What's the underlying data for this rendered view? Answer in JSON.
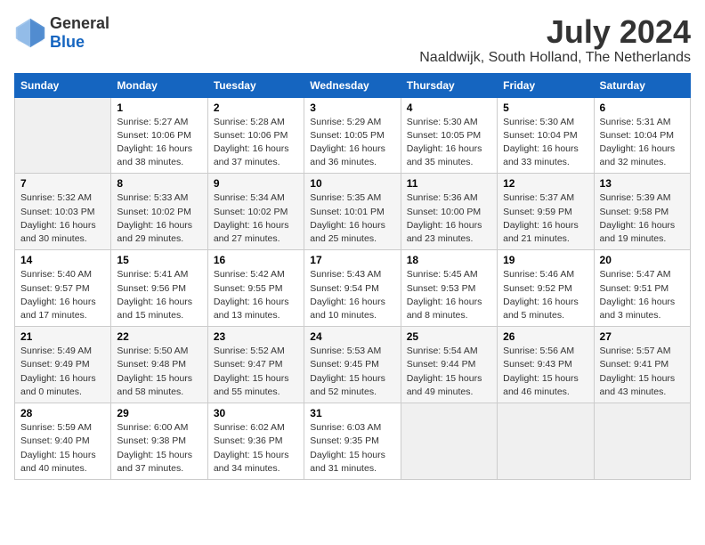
{
  "header": {
    "logo_general": "General",
    "logo_blue": "Blue",
    "month": "July 2024",
    "location": "Naaldwijk, South Holland, The Netherlands"
  },
  "days_of_week": [
    "Sunday",
    "Monday",
    "Tuesday",
    "Wednesday",
    "Thursday",
    "Friday",
    "Saturday"
  ],
  "weeks": [
    [
      {
        "day": "",
        "info": ""
      },
      {
        "day": "1",
        "info": "Sunrise: 5:27 AM\nSunset: 10:06 PM\nDaylight: 16 hours\nand 38 minutes."
      },
      {
        "day": "2",
        "info": "Sunrise: 5:28 AM\nSunset: 10:06 PM\nDaylight: 16 hours\nand 37 minutes."
      },
      {
        "day": "3",
        "info": "Sunrise: 5:29 AM\nSunset: 10:05 PM\nDaylight: 16 hours\nand 36 minutes."
      },
      {
        "day": "4",
        "info": "Sunrise: 5:30 AM\nSunset: 10:05 PM\nDaylight: 16 hours\nand 35 minutes."
      },
      {
        "day": "5",
        "info": "Sunrise: 5:30 AM\nSunset: 10:04 PM\nDaylight: 16 hours\nand 33 minutes."
      },
      {
        "day": "6",
        "info": "Sunrise: 5:31 AM\nSunset: 10:04 PM\nDaylight: 16 hours\nand 32 minutes."
      }
    ],
    [
      {
        "day": "7",
        "info": "Sunrise: 5:32 AM\nSunset: 10:03 PM\nDaylight: 16 hours\nand 30 minutes."
      },
      {
        "day": "8",
        "info": "Sunrise: 5:33 AM\nSunset: 10:02 PM\nDaylight: 16 hours\nand 29 minutes."
      },
      {
        "day": "9",
        "info": "Sunrise: 5:34 AM\nSunset: 10:02 PM\nDaylight: 16 hours\nand 27 minutes."
      },
      {
        "day": "10",
        "info": "Sunrise: 5:35 AM\nSunset: 10:01 PM\nDaylight: 16 hours\nand 25 minutes."
      },
      {
        "day": "11",
        "info": "Sunrise: 5:36 AM\nSunset: 10:00 PM\nDaylight: 16 hours\nand 23 minutes."
      },
      {
        "day": "12",
        "info": "Sunrise: 5:37 AM\nSunset: 9:59 PM\nDaylight: 16 hours\nand 21 minutes."
      },
      {
        "day": "13",
        "info": "Sunrise: 5:39 AM\nSunset: 9:58 PM\nDaylight: 16 hours\nand 19 minutes."
      }
    ],
    [
      {
        "day": "14",
        "info": "Sunrise: 5:40 AM\nSunset: 9:57 PM\nDaylight: 16 hours\nand 17 minutes."
      },
      {
        "day": "15",
        "info": "Sunrise: 5:41 AM\nSunset: 9:56 PM\nDaylight: 16 hours\nand 15 minutes."
      },
      {
        "day": "16",
        "info": "Sunrise: 5:42 AM\nSunset: 9:55 PM\nDaylight: 16 hours\nand 13 minutes."
      },
      {
        "day": "17",
        "info": "Sunrise: 5:43 AM\nSunset: 9:54 PM\nDaylight: 16 hours\nand 10 minutes."
      },
      {
        "day": "18",
        "info": "Sunrise: 5:45 AM\nSunset: 9:53 PM\nDaylight: 16 hours\nand 8 minutes."
      },
      {
        "day": "19",
        "info": "Sunrise: 5:46 AM\nSunset: 9:52 PM\nDaylight: 16 hours\nand 5 minutes."
      },
      {
        "day": "20",
        "info": "Sunrise: 5:47 AM\nSunset: 9:51 PM\nDaylight: 16 hours\nand 3 minutes."
      }
    ],
    [
      {
        "day": "21",
        "info": "Sunrise: 5:49 AM\nSunset: 9:49 PM\nDaylight: 16 hours\nand 0 minutes."
      },
      {
        "day": "22",
        "info": "Sunrise: 5:50 AM\nSunset: 9:48 PM\nDaylight: 15 hours\nand 58 minutes."
      },
      {
        "day": "23",
        "info": "Sunrise: 5:52 AM\nSunset: 9:47 PM\nDaylight: 15 hours\nand 55 minutes."
      },
      {
        "day": "24",
        "info": "Sunrise: 5:53 AM\nSunset: 9:45 PM\nDaylight: 15 hours\nand 52 minutes."
      },
      {
        "day": "25",
        "info": "Sunrise: 5:54 AM\nSunset: 9:44 PM\nDaylight: 15 hours\nand 49 minutes."
      },
      {
        "day": "26",
        "info": "Sunrise: 5:56 AM\nSunset: 9:43 PM\nDaylight: 15 hours\nand 46 minutes."
      },
      {
        "day": "27",
        "info": "Sunrise: 5:57 AM\nSunset: 9:41 PM\nDaylight: 15 hours\nand 43 minutes."
      }
    ],
    [
      {
        "day": "28",
        "info": "Sunrise: 5:59 AM\nSunset: 9:40 PM\nDaylight: 15 hours\nand 40 minutes."
      },
      {
        "day": "29",
        "info": "Sunrise: 6:00 AM\nSunset: 9:38 PM\nDaylight: 15 hours\nand 37 minutes."
      },
      {
        "day": "30",
        "info": "Sunrise: 6:02 AM\nSunset: 9:36 PM\nDaylight: 15 hours\nand 34 minutes."
      },
      {
        "day": "31",
        "info": "Sunrise: 6:03 AM\nSunset: 9:35 PM\nDaylight: 15 hours\nand 31 minutes."
      },
      {
        "day": "",
        "info": ""
      },
      {
        "day": "",
        "info": ""
      },
      {
        "day": "",
        "info": ""
      }
    ]
  ]
}
